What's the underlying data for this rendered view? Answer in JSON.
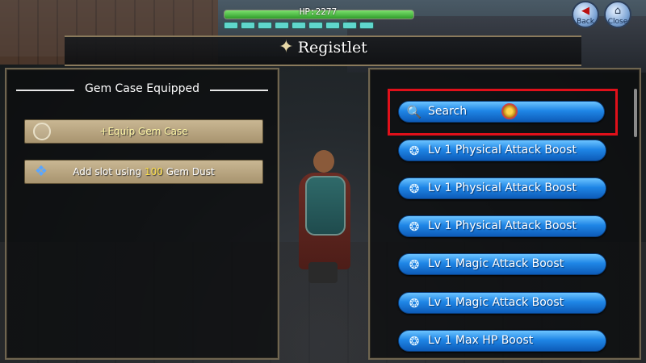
{
  "hud": {
    "hp_label": "HP:2277",
    "hp_fill_fraction": 1.0,
    "sp_segments": 9,
    "back_label": "Back",
    "close_label": "Close"
  },
  "title": {
    "text": "Registlet",
    "icon": "gem-tools-icon"
  },
  "left_panel": {
    "heading": "Gem Case Equipped",
    "equip_row": {
      "label": "+Equip Gem Case",
      "icon": "empty-circle-icon"
    },
    "slot_row": {
      "prefix": "Add slot using ",
      "amount": "100",
      "suffix": " Gem Dust",
      "icon": "gem-dust-icon"
    }
  },
  "right_panel": {
    "search": {
      "label": "Search",
      "icon": "magnifier-icon",
      "badge_icon": "gold-coin-icon"
    },
    "items": [
      {
        "label": "Lv  1 Physical Attack Boost",
        "icon": "registlet-card-icon"
      },
      {
        "label": "Lv  1 Physical Attack Boost",
        "icon": "registlet-card-icon"
      },
      {
        "label": "Lv  1 Physical Attack Boost",
        "icon": "registlet-card-icon"
      },
      {
        "label": "Lv  1 Magic Attack Boost",
        "icon": "registlet-card-icon"
      },
      {
        "label": "Lv  1 Magic Attack Boost",
        "icon": "registlet-card-icon"
      },
      {
        "label": "Lv  1 Max HP Boost",
        "icon": "registlet-card-icon"
      }
    ]
  },
  "colors": {
    "highlight": "#e0101a",
    "button_blue": "#1f86e6",
    "tan_row": "#b9a680"
  }
}
